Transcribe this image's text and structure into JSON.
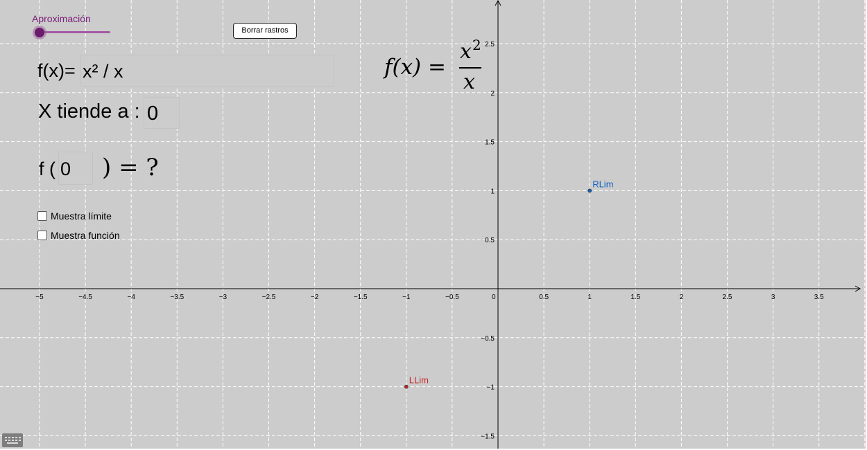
{
  "slider": {
    "label": "Aproximación",
    "value": 0
  },
  "buttons": {
    "clear_traces": "Borrar rastros"
  },
  "function_input": {
    "label": "f(x)=",
    "value": "x² / x"
  },
  "approach_input": {
    "label": "X tiende a :",
    "value": "0"
  },
  "evaluation": {
    "label": "f (",
    "value": "0",
    "rest": ") = ?"
  },
  "checkboxes": [
    {
      "label": "Muestra límite",
      "checked": false
    },
    {
      "label": "Muestra función",
      "checked": false
    }
  ],
  "formula": {
    "lhs": "f(x) =",
    "numerator": "x",
    "exponent": "2",
    "denominator": "x"
  },
  "graph": {
    "x_ticks": [
      "−5",
      "−4.5",
      "−4",
      "−3.5",
      "−3",
      "−2.5",
      "−2",
      "−1.5",
      "−1",
      "−0.5",
      "0",
      "0.5",
      "1",
      "1.5",
      "2",
      "2.5",
      "3",
      "3.5"
    ],
    "y_ticks": [
      "2.5",
      "2",
      "1.5",
      "1",
      "0.5",
      "−0.5",
      "−1",
      "−1.5"
    ],
    "points": [
      {
        "label": "RLim",
        "x": 1,
        "y": 1,
        "color": "#1565c0"
      },
      {
        "label": "LLim",
        "x": -1,
        "y": -1,
        "color": "#c62828"
      }
    ]
  },
  "colors": {
    "background": "#cccccc",
    "slider": "#7a1e7a"
  }
}
